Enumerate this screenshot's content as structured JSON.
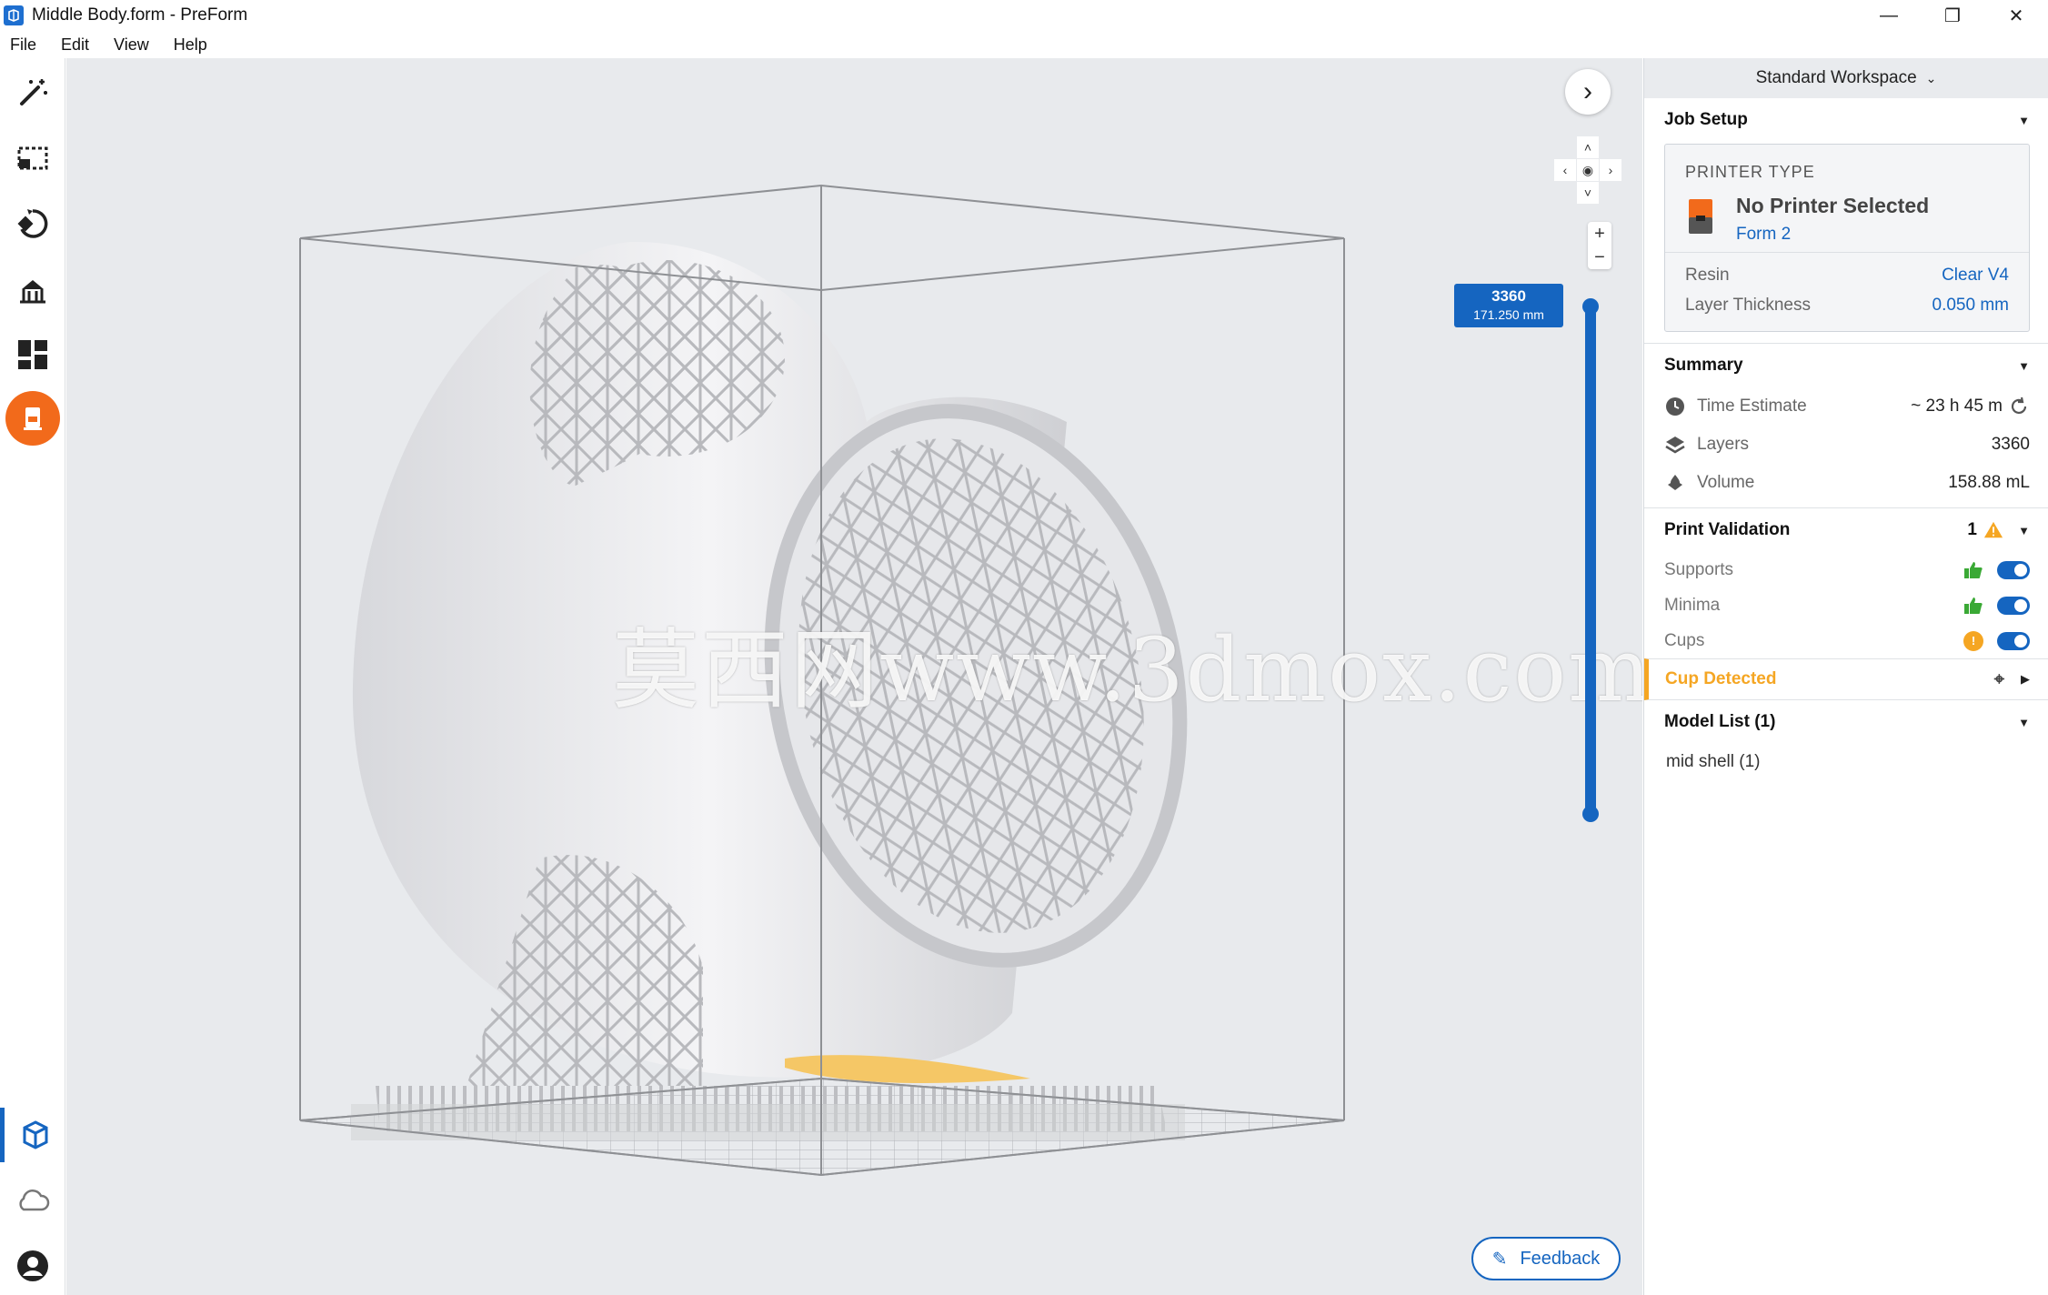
{
  "window": {
    "title": "Middle Body.form - PreForm",
    "minimize": "—",
    "restore": "❐",
    "close": "✕"
  },
  "menu": [
    "File",
    "Edit",
    "View",
    "Help"
  ],
  "left_tools": [
    "magic-wand-icon",
    "selection-icon",
    "orientation-icon",
    "supports-icon",
    "layout-icon",
    "print-icon"
  ],
  "left_bottom": [
    "local-printer-icon",
    "cloud-icon",
    "account-icon"
  ],
  "viewport": {
    "watermark": "莫西网www.3dmox.com",
    "layer_number": "3360",
    "layer_height": "171.250 mm",
    "layer_slider_level": 1.0,
    "feedback_label": "Feedback"
  },
  "panel": {
    "workspace": "Standard Workspace",
    "job_setup": {
      "title": "Job Setup",
      "printer_type_label": "PRINTER TYPE",
      "printer_name": "No Printer Selected",
      "printer_model": "Form 2",
      "resin_label": "Resin",
      "resin_value": "Clear V4",
      "thickness_label": "Layer Thickness",
      "thickness_value": "0.050 mm"
    },
    "summary": {
      "title": "Summary",
      "time_label": "Time Estimate",
      "time_value": "~ 23 h 45 m",
      "layers_label": "Layers",
      "layers_value": "3360",
      "volume_label": "Volume",
      "volume_value": "158.88 mL"
    },
    "validation": {
      "title": "Print Validation",
      "count": "1",
      "items": [
        {
          "label": "Supports",
          "status": "ok",
          "enabled": true
        },
        {
          "label": "Minima",
          "status": "ok",
          "enabled": true
        },
        {
          "label": "Cups",
          "status": "warning",
          "enabled": true
        }
      ],
      "warning_badge": "!"
    },
    "cup_detected": "Cup Detected",
    "model_list": {
      "title": "Model List (1)",
      "items": [
        "mid shell (1)"
      ]
    }
  },
  "colors": {
    "accent": "#1565c0",
    "orange": "#f26a1b",
    "warning": "#f5a623",
    "ok_green": "#3aa935"
  }
}
